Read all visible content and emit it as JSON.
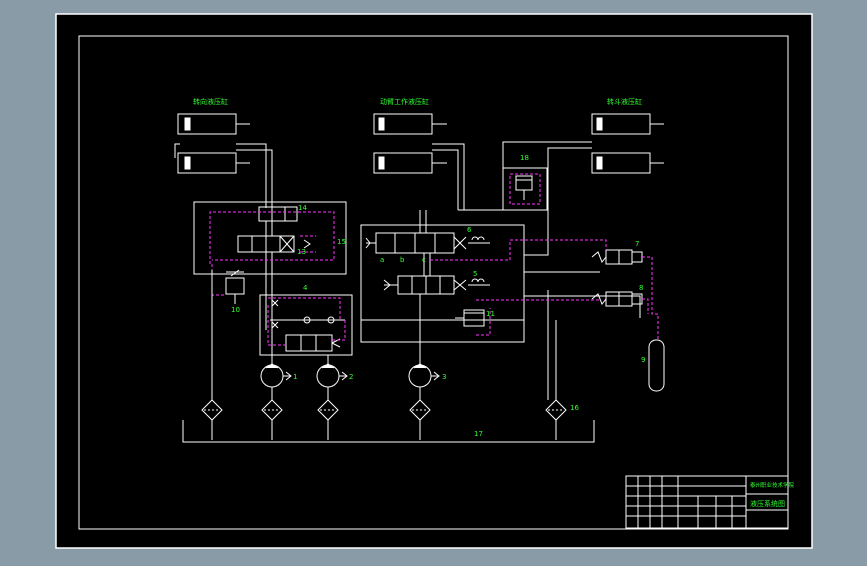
{
  "colors": {
    "background": "#8a9ba8",
    "sheet": "#000000",
    "line": "#ffffff",
    "pilot_line": "#ff33ff",
    "label": "#33ff33",
    "title_text": "#33ff33"
  },
  "titles": {
    "left_cylinder": "转向液压缸",
    "middle_cylinder": "动臂工作液压缸",
    "right_cylinder": "转斗液压缸"
  },
  "labels": {
    "n1": "1",
    "n2": "2",
    "n3": "3",
    "n4": "4",
    "n5": "5",
    "n6": "6",
    "n7": "7",
    "n8": "8",
    "n9": "9",
    "n10": "10",
    "n11": "11",
    "n13": "13",
    "n14": "14",
    "n15": "15",
    "n16": "16",
    "n17": "17",
    "n18": "18",
    "a": "a",
    "b": "b",
    "c": "c"
  },
  "title_block": {
    "school": "泰州职业技术学院",
    "drawing_name": "液压系统图"
  }
}
